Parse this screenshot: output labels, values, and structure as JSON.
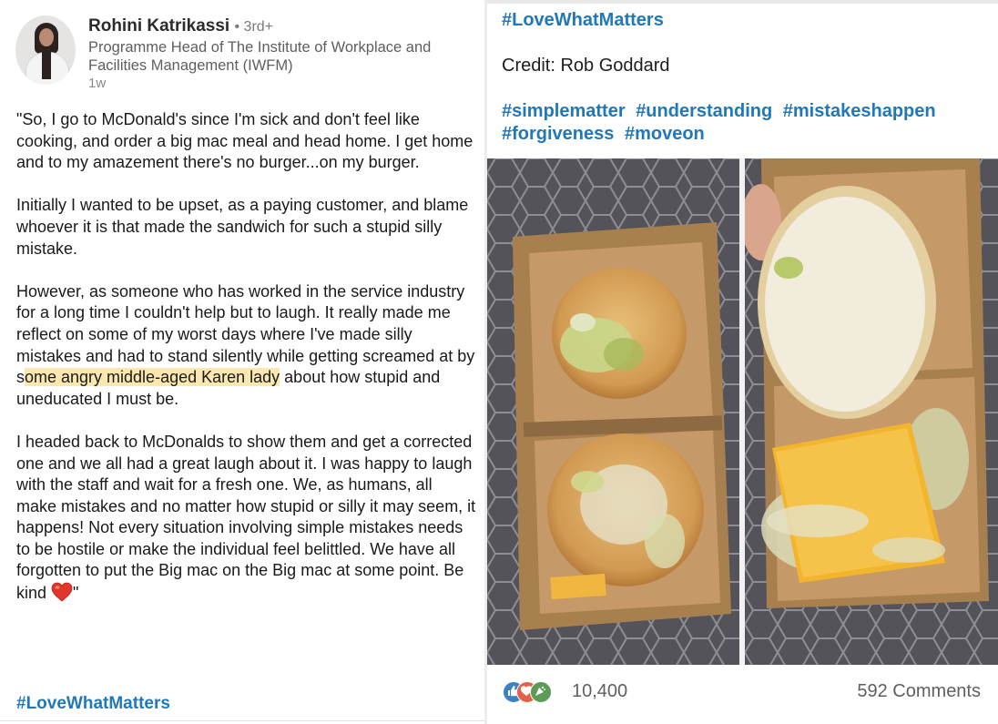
{
  "author": {
    "name": "Rohini Katrikassi",
    "degree": "• 3rd+",
    "headline": "Programme Head of The Institute of Workplace and Facilities Management (IWFM)",
    "time": "1w"
  },
  "post": {
    "p1": "\"So, I go to McDonald's since I'm sick and don't feel like cooking, and order a big mac meal and head home. I get home and to my amazement there's no burger...on my burger.",
    "p2": "Initially I wanted to be upset, as a paying customer, and blame whoever it is that made the sandwich for such a stupid silly mistake.",
    "p3_before": "However, as someone who has worked in the service industry for a long time I couldn't help but to laugh. It really made me reflect on some of my worst days where I've made silly mistakes and had to stand silently while getting screamed at by s",
    "p3_highlight": "ome angry middle-aged Karen lady",
    "p3_after": " about how stupid and uneducated I must be.",
    "p4": "I headed back to McDonalds to show them and get a corrected one and we all had a great laugh about it. I was happy to laugh with the staff and wait for a fresh one. We, as humans, all make mistakes and no matter how stupid or silly it may seem, it happens! Not every situation involving simple mistakes needs to be hostile or make the individual feel belittled. We have all forgotten to put the Big mac on the Big mac at some point. Be kind",
    "p4_end": "\"",
    "hashtag": "#LoveWhatMatters"
  },
  "right": {
    "hashtag": "#LoveWhatMatters",
    "credit": "Credit: Rob Goddard",
    "tags": [
      "#simplematter",
      "#understanding",
      "#mistakeshappen",
      "#forgiveness",
      "#moveon"
    ]
  },
  "social": {
    "reaction_count": "10,400",
    "comments": "592 Comments",
    "reaction_icons": [
      "like-icon",
      "love-icon",
      "celebrate-icon"
    ]
  },
  "colors": {
    "link": "#1f78b8",
    "highlight": "#fbe8b0",
    "heart": "#e0362b"
  }
}
